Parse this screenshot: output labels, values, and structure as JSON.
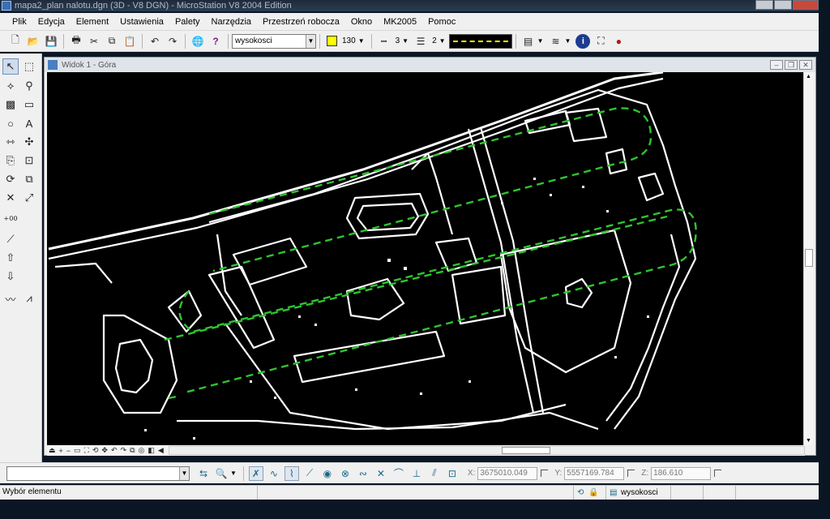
{
  "window": {
    "title": "mapa2_plan nalotu.dgn (3D - V8 DGN) - MicroStation V8 2004 Edition"
  },
  "menu": [
    "Plik",
    "Edycja",
    "Element",
    "Ustawienia",
    "Palety",
    "Narzędzia",
    "Przestrzeń robocza",
    "Okno",
    "MK2005",
    "Pomoc"
  ],
  "toolbar": {
    "level": "wysokosci",
    "color": "130",
    "line_style": "3",
    "weight": "2",
    "color_hex": "#ffff00"
  },
  "view": {
    "title": "Widok 1 - Góra"
  },
  "bottom": {
    "command_input": ""
  },
  "coordinates": {
    "x_label": "X:",
    "x": "3675010.049",
    "y_label": "Y:",
    "y": "5557169.784",
    "z_label": "Z:",
    "z": "186.610"
  },
  "status": {
    "message": "Wybór elementu",
    "active_level": "wysokosci"
  },
  "icons": [
    "new-file-icon",
    "open-icon",
    "save-icon",
    "print-icon",
    "cut-icon",
    "copy-icon",
    "paste-icon",
    "undo-icon",
    "redo-icon",
    "globe-icon",
    "help-icon",
    "info-icon",
    "selection-arrow-icon",
    "lock-icon"
  ]
}
